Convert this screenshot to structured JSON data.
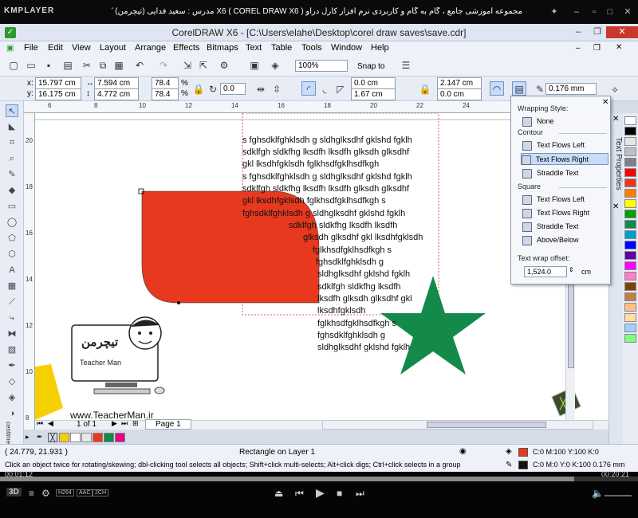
{
  "player": {
    "logo": "KMPLAYER",
    "title": "مجموعه آموزشی جامع ، گام به گام و کاربردی نرم افزار کارل دراو X6 ( COREL DRAW X6 )   مدرس : سعید فدایی (تیچرمن) گروه آموزشی پادشاه گرافیست ها",
    "time_elapsed": "00:01:12",
    "time_total": "00:20:21",
    "progress": 0.9,
    "badges": [
      "H264",
      "AAC",
      "2CH"
    ]
  },
  "app": {
    "title": "CorelDRAW X6 - [C:\\Users\\elahe\\Desktop\\corel draw saves\\save.cdr]",
    "menu": [
      "File",
      "Edit",
      "View",
      "Layout",
      "Arrange",
      "Effects",
      "Bitmaps",
      "Text",
      "Table",
      "Tools",
      "Window",
      "Help"
    ],
    "toolbar": {
      "zoom": "100%",
      "snap_to": "Snap to"
    },
    "property_bar": {
      "x": "15.797 cm",
      "y": "16.175 cm",
      "w": "7.594 cm",
      "h": "4.772 cm",
      "scale_w": "78.4",
      "scale_h": "78.4",
      "pct": "%",
      "rotation": "0.0",
      "corner_1": "0.0 cm",
      "corner_2": "1.67 cm",
      "corner_3": "2.147 cm",
      "corner_4": "0.0 cm",
      "outline": "0.176 mm",
      "x_label": "x:",
      "y_label": "y:"
    },
    "rulers": {
      "h_ticks": [
        "6",
        "8",
        "10",
        "12",
        "14",
        "16",
        "18",
        "20",
        "22",
        "24"
      ],
      "v_ticks": [
        "20",
        "18",
        "16",
        "14",
        "12",
        "10",
        "8"
      ],
      "unit": "centimeters"
    },
    "wrap_popup": {
      "heading": "Wrapping Style:",
      "none": "None",
      "contour_label": "Contour",
      "contour_items": [
        "Text Flows Left",
        "Text Flows Right",
        "Straddle Text"
      ],
      "square_label": "Square",
      "square_items": [
        "Text Flows Left",
        "Text Flows Right",
        "Straddle Text",
        "Above/Below"
      ],
      "offset_label": "Text wrap offset:",
      "offset_value": "1,524.0",
      "offset_unit": "cm"
    },
    "docker_tab": "Text Properties",
    "paragraph_lines": [
      "s fghsdklfghklsdh g sldhglksdhf gklshd fgklh",
      "sdklfgh sldkfhg lksdfh lksdfh glksdh glksdhf",
      "gkl lksdhfgklsdh fglkhsdfgklhsdfkgh",
      "s fghsdklfghklsdh g sldhglksdhf gklshd fgklh",
      "sdklfgh sldkfhg lksdfh lksdfh glksdh glksdhf",
      "gkl lksdhfgklsdh fglkhsdfgklhsdfkgh s",
      "fghsdklfghklsdh g sldhglksdhf gklshd fgklh",
      "sdklfgh sldkfhg lksdfh lksdfh",
      "glksdh glksdhf gkl lksdhfgklsdh",
      "fglkhsdfgklhsdfkgh s",
      "fghsdklfghklsdh g",
      "sldhglksdhf gklshd fgklh",
      "sdklfgh sldkfhg lksdfh",
      "lksdfh glksdh glksdhf gkl",
      "lksdhfgklsdh",
      "fglkhsdfgklhsdfkgh s",
      "fghsdklfghklsdh g",
      "sldhglksdhf gklshd fgklh"
    ],
    "watermark": "www.TeacherMan.ir",
    "mascot_text": "Teacher Man",
    "mascot_logo": "تیچرمن",
    "pager": {
      "page_of": "1 of 1",
      "page_tab": "Page 1"
    },
    "status": {
      "coords": "( 24.779, 21.931 )",
      "object_info": "Rectangle on Layer 1",
      "hint": "Click an object twice for rotating/skewing; dbl-clicking tool selects all objects; Shift+click multi-selects; Alt+click digs; Ctrl+click selects in a group",
      "fill_info": "C:0 M:100 Y:100 K:0",
      "outline_info": "C:0 M:0 Y:0 K:100  0.176 mm"
    },
    "colors": {
      "shape_red": "#e8391f",
      "star_green": "#138a4a",
      "yellow": "#f6d000",
      "accent": "#2e9a2e"
    },
    "palette": [
      "#ffffff",
      "#000000",
      "#e6e6e6",
      "#c0c0c0",
      "#808080",
      "#ff0000",
      "#e8391f",
      "#ff8000",
      "#ffff00",
      "#00a000",
      "#138a4a",
      "#00a0c0",
      "#0000ff",
      "#6000a0",
      "#ff00ff",
      "#ff80c0",
      "#804000",
      "#c08040",
      "#ffc080",
      "#ffe0a0",
      "#a0d0ff",
      "#80ff80"
    ],
    "doc_palette": [
      "#f6d000",
      "#ffffff",
      "#e8e8e8",
      "#e8391f",
      "#138a4a",
      "#e6007e"
    ]
  }
}
